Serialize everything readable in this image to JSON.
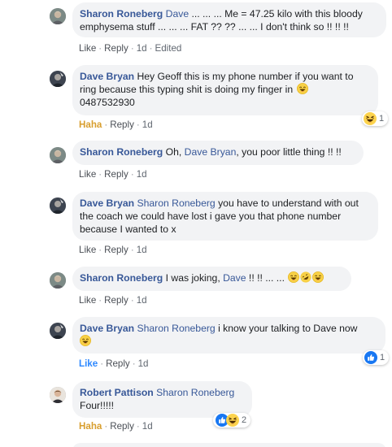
{
  "comments": [
    {
      "author": "Sharon Roneberg",
      "mention": "Dave",
      "text_parts": [
        " ... ... ... Me = 47.25 kilo with this bloody",
        "emphysema stuff ... ... ... FAT ?? ?? ... ... I don't think so !! !! !!"
      ],
      "actions": {
        "like": "Like",
        "reply": "Reply",
        "time": "1d",
        "edited": "Edited"
      }
    },
    {
      "author": "Dave Bryan",
      "text_parts": [
        "Hey Geoff this is my phone number if you want to",
        "ring because this typing shit is doing my finger in",
        "0487532930"
      ],
      "actions": {
        "reaction": "Haha",
        "reply": "Reply",
        "time": "1d"
      },
      "reaction_count": "1",
      "reaction_icon": "haha-icon"
    },
    {
      "author": "Sharon Roneberg",
      "text_pre": "Oh, ",
      "mention": "Dave Bryan",
      "text_post": ", you poor little thing !! !!",
      "actions": {
        "like": "Like",
        "reply": "Reply",
        "time": "1d"
      }
    },
    {
      "author": "Dave Bryan",
      "mention": "Sharon Roneberg",
      "text_parts": [
        " you have to understand with out",
        "the coach we could have lost i gave you that phone number",
        "because I wanted to x"
      ],
      "actions": {
        "like": "Like",
        "reply": "Reply",
        "time": "1d"
      }
    },
    {
      "author": "Sharon Roneberg",
      "text_pre": "I was joking, ",
      "mention": "Dave",
      "text_post": " !! !! ... ... ",
      "actions": {
        "like": "Like",
        "reply": "Reply",
        "time": "1d"
      }
    },
    {
      "author": "Dave Bryan",
      "mention": "Sharon Roneberg",
      "text_post": " i know your talking to Dave now",
      "actions": {
        "reaction": "Like",
        "reply": "Reply",
        "time": "1d"
      },
      "reaction_count": "1",
      "reaction_icon": "like-icon"
    },
    {
      "author": "Robert Pattison",
      "mention": "Sharon Roneberg",
      "text_line2": "Four!!!!!",
      "actions": {
        "reaction": "Haha",
        "reply": "Reply",
        "time": "1d"
      },
      "reaction_count": "2",
      "reaction_icons": [
        "like-icon",
        "haha-icon"
      ]
    }
  ],
  "colors": {
    "author": "#385898",
    "bubble": "#f2f3f5",
    "haha": "#d89e2e",
    "like": "#2d88ff",
    "meta": "#606770"
  }
}
